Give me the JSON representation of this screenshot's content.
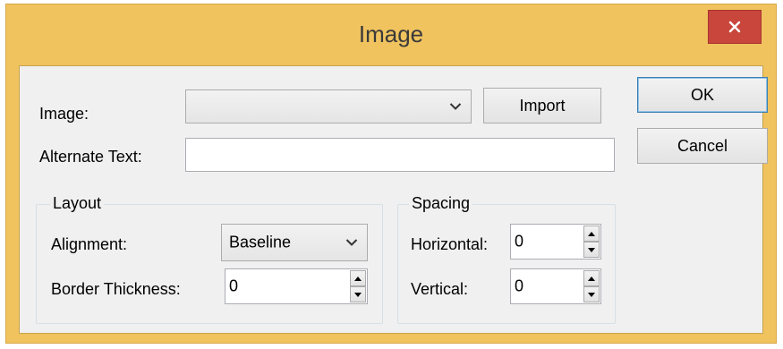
{
  "window": {
    "title": "Image",
    "close_icon": "close-icon",
    "frame_color": "#f0c35f",
    "close_color": "#c9463d"
  },
  "image_row": {
    "label": "Image:",
    "selected_value": "",
    "import_label": "Import"
  },
  "alt_text": {
    "label": "Alternate Text:",
    "value": ""
  },
  "buttons": {
    "ok_label": "OK",
    "cancel_label": "Cancel"
  },
  "layout_group": {
    "title": "Layout",
    "alignment_label": "Alignment:",
    "alignment_value": "Baseline",
    "border_label": "Border Thickness:",
    "border_value": "0"
  },
  "spacing_group": {
    "title": "Spacing",
    "horizontal_label": "Horizontal:",
    "horizontal_value": "0",
    "vertical_label": "Vertical:",
    "vertical_value": "0"
  }
}
